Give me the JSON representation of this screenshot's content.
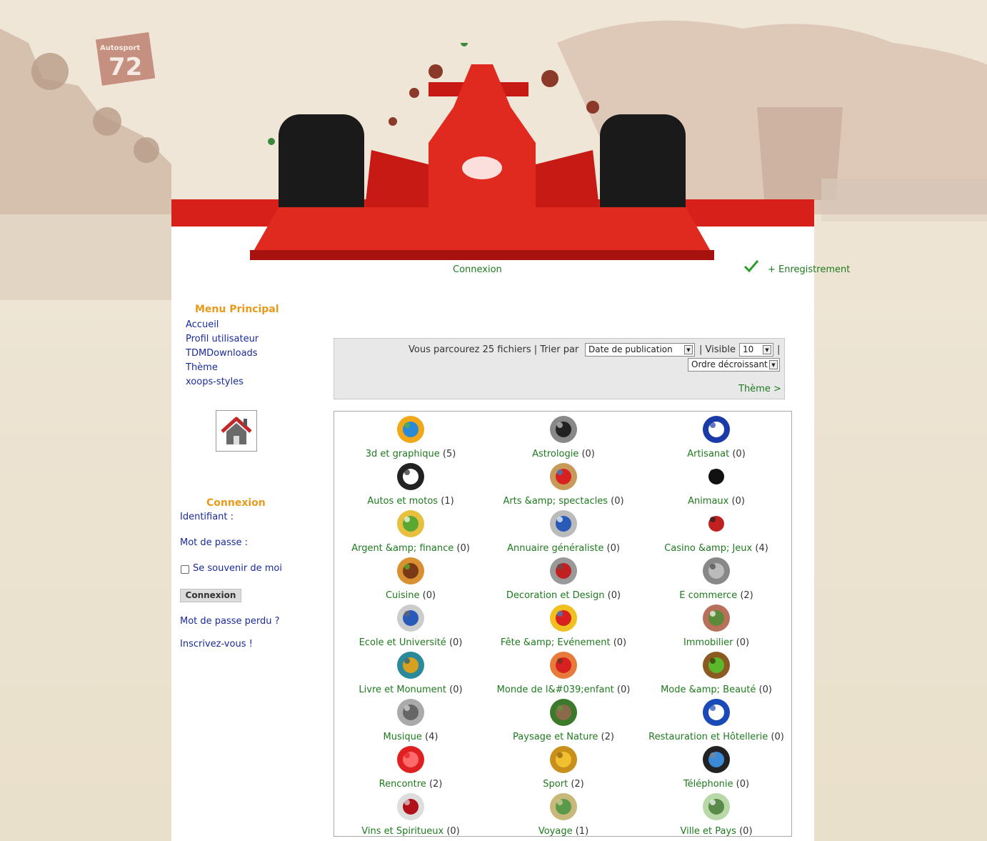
{
  "header": {
    "login_link": "Connexion",
    "register_link": "+ Enregistrement",
    "car_number": "72",
    "car_sponsor": "Autosport"
  },
  "main_menu": {
    "title": "Menu Principal",
    "items": [
      "Accueil",
      "Profil utilisateur",
      "TDMDownloads",
      "Thème",
      "xoops-styles"
    ]
  },
  "login_block": {
    "title": "Connexion",
    "username_label": "Identifiant :",
    "password_label": "Mot de passe :",
    "remember_label": "Se souvenir de moi",
    "submit_label": "Connexion",
    "lost_password": "Mot de passe perdu ?",
    "register": "Inscrivez-vous !"
  },
  "filter": {
    "browsing_text": "Vous parcourez 25 fichiers | Trier par",
    "sort_value": "Date de publication",
    "visible_text": "| Visible",
    "visible_value": "10",
    "pipe": "|",
    "order_value": "Ordre décroissant",
    "theme_link": "Thème >"
  },
  "categories": [
    {
      "name": "3d et graphique",
      "count": "(5)",
      "icon": "pie-chart-icon"
    },
    {
      "name": "Astrologie",
      "count": "(0)",
      "icon": "crab-zodiac-icon"
    },
    {
      "name": "Artisanat",
      "count": "(0)",
      "icon": "craft-logo-icon"
    },
    {
      "name": "Autos et motos",
      "count": "(1)",
      "icon": "motorbike-icon"
    },
    {
      "name": "Arts &amp; spectacles",
      "count": "(0)",
      "icon": "palette-icon"
    },
    {
      "name": "Animaux",
      "count": "(0)",
      "icon": "panda-icon"
    },
    {
      "name": "Argent &amp; finance",
      "count": "(0)",
      "icon": "money-icon"
    },
    {
      "name": "Annuaire généraliste",
      "count": "(0)",
      "icon": "magnifier-icon"
    },
    {
      "name": "Casino &amp; Jeux",
      "count": "(4)",
      "icon": "cards-icon"
    },
    {
      "name": "Cuisine",
      "count": "(0)",
      "icon": "burger-icon"
    },
    {
      "name": "Decoration et Design",
      "count": "(0)",
      "icon": "sofa-icon"
    },
    {
      "name": "E commerce",
      "count": "(2)",
      "icon": "cash-register-icon"
    },
    {
      "name": "Ecole et Université",
      "count": "(0)",
      "icon": "set-square-icon"
    },
    {
      "name": "Fête &amp; Evénement",
      "count": "(0)",
      "icon": "party-hat-icon"
    },
    {
      "name": "Immobilier",
      "count": "(0)",
      "icon": "house-icon"
    },
    {
      "name": "Livre et Monument",
      "count": "(0)",
      "icon": "books-icon"
    },
    {
      "name": "Monde de l&#039;enfant",
      "count": "(0)",
      "icon": "child-icon"
    },
    {
      "name": "Mode &amp; Beauté",
      "count": "(0)",
      "icon": "boot-icon"
    },
    {
      "name": "Musique",
      "count": "(4)",
      "icon": "speaker-icon"
    },
    {
      "name": "Paysage et Nature",
      "count": "(2)",
      "icon": "trees-icon"
    },
    {
      "name": "Restauration et Hôtellerie",
      "count": "(0)",
      "icon": "fork-knife-icon"
    },
    {
      "name": "Rencontre",
      "count": "(2)",
      "icon": "heart-icon"
    },
    {
      "name": "Sport",
      "count": "(2)",
      "icon": "trophy-icon"
    },
    {
      "name": "Téléphonie",
      "count": "(0)",
      "icon": "phone-icon"
    },
    {
      "name": "Vins et Spiritueux",
      "count": "(0)",
      "icon": "wine-glass-icon"
    },
    {
      "name": "Voyage",
      "count": "(1)",
      "icon": "airplane-icon"
    },
    {
      "name": "Ville et Pays",
      "count": "(0)",
      "icon": "france-map-icon"
    }
  ],
  "colors": {
    "accent_red": "#d8201a",
    "link_green": "#1e7a1e",
    "link_blue": "#1a2b9a",
    "block_title_orange": "#e89a1a"
  }
}
